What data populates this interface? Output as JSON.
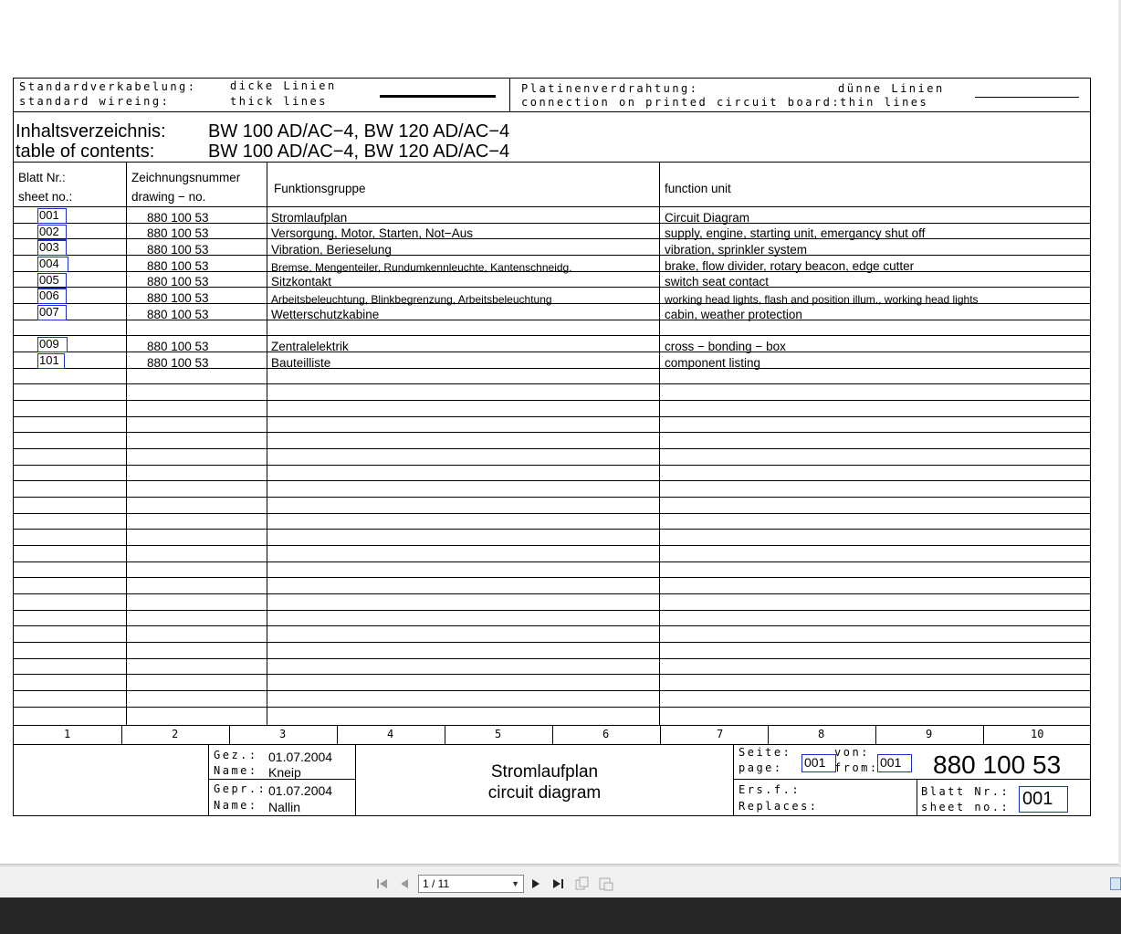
{
  "legend": {
    "std_wiring_de": "Standardverkabelung:",
    "std_wiring_en": "standard wireing:",
    "thick_de": "dicke Linien",
    "thick_en": "thick lines",
    "pcb_de": "Platinenverdrahtung:",
    "pcb_en": "connection on printed circuit board:",
    "thin_de": "dünne Linien",
    "thin_en": "thin lines"
  },
  "title": {
    "label_de": "Inhaltsverzeichnis:",
    "label_en": "table of contents:",
    "models_de": "BW 100 AD/AC−4, BW 120 AD/AC−4",
    "models_en": "BW 100 AD/AC−4, BW 120 AD/AC−4"
  },
  "headers": {
    "sheet_de": "Blatt Nr.:",
    "sheet_en": "sheet no.:",
    "drawing_de": "Zeichnungsnummer",
    "drawing_en": "drawing − no.",
    "func_de": "Funktionsgruppe",
    "func_en": "function unit"
  },
  "rows": [
    {
      "sheet": "001",
      "drawing": "880 100 53",
      "de": "Stromlaufplan",
      "en": "Circuit Diagram"
    },
    {
      "sheet": "002",
      "drawing": "880 100 53",
      "de": "Versorgung, Motor, Starten, Not−Aus",
      "en": "supply, engine, starting unit, emergancy shut off"
    },
    {
      "sheet": "003",
      "drawing": "880 100 53",
      "de": "Vibration, Berieselung",
      "en": "vibration, sprinkler system"
    },
    {
      "sheet": "004",
      "drawing": "880 100 53",
      "de": "Bremse, Mengenteiler, Rundumkennleuchte, Kantenschneidg.",
      "en": "brake, flow divider, rotary beacon, edge cutter"
    },
    {
      "sheet": "005",
      "drawing": "880 100 53",
      "de": "Sitzkontakt",
      "en": "switch seat contact"
    },
    {
      "sheet": "006",
      "drawing": "880 100 53",
      "de": "Arbeitsbeleuchtung, Blinkbegrenzung, Arbeitsbeleuchtung",
      "en": "working head lights, flash and position illum., working head lights"
    },
    {
      "sheet": "007",
      "drawing": "880 100 53",
      "de": "Wetterschutzkabine",
      "en": "cabin, weather protection"
    },
    {
      "sheet": "009",
      "drawing": "880 100 53",
      "de": "Zentralelektrik",
      "en": "cross − bonding − box"
    },
    {
      "sheet": "101",
      "drawing": "880 100 53",
      "de": "Bauteilliste",
      "en": "component listing"
    }
  ],
  "columns": [
    "1",
    "2",
    "3",
    "4",
    "5",
    "6",
    "7",
    "8",
    "9",
    "10"
  ],
  "titleblock": {
    "drawn_label": "Gez.:",
    "drawn_date": "01.07.2004",
    "name_label_1": "Name:",
    "drawn_name": "Kneip",
    "checked_label": "Gepr.:",
    "checked_date": "01.07.2004",
    "name_label_2": "Name:",
    "checked_name": "Nallin",
    "doc_title_de": "Stromlaufplan",
    "doc_title_en": "circuit diagram",
    "seite_label": "Seite:",
    "page_label": "page:",
    "page_value": "001",
    "von_label": "von:",
    "from_label": "from:",
    "from_value": "001",
    "doc_number": "880 100 53",
    "ersf_label": "Ers.f.:",
    "replaces_label": "Replaces:",
    "blatt_label": "Blatt Nr.:",
    "sheetno_label": "sheet no.:",
    "sheet_value": "001"
  },
  "toolbar": {
    "page_indicator": "1 / 11",
    "icons": [
      "first-page-icon",
      "previous-page-icon",
      "next-page-icon",
      "last-page-icon",
      "copy-icon",
      "export-icon"
    ]
  },
  "colors": {
    "link_border": "#1a2fd0"
  }
}
